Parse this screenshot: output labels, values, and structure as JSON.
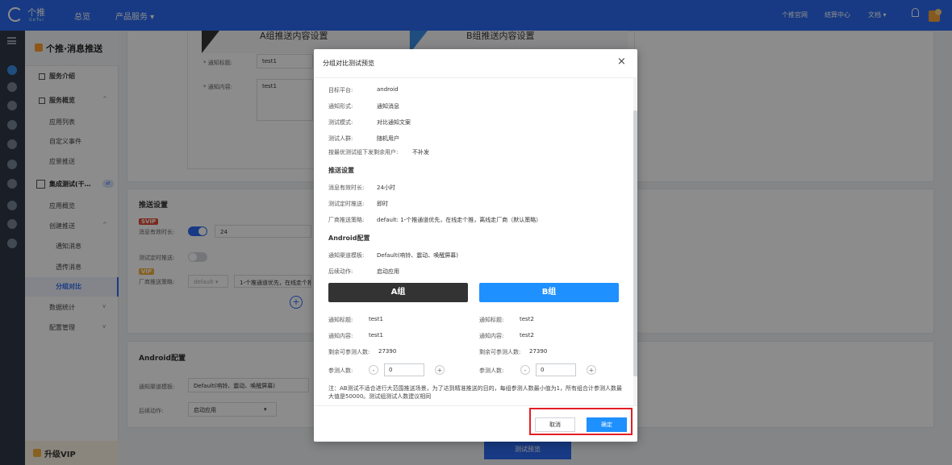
{
  "topbar": {
    "logo_text": "个推",
    "logo_sub": "GeTui",
    "nav": [
      "总览",
      "产品服务 ▾"
    ],
    "right": [
      "个推官网",
      "结算中心",
      "文档 ▾"
    ]
  },
  "sidebar": {
    "title": "个推·消息推送",
    "items": [
      {
        "label": "服务介绍"
      },
      {
        "label": "服务概览",
        "chev": "^"
      },
      {
        "label": "应用列表"
      },
      {
        "label": "自定义事件"
      },
      {
        "label": "应景推送"
      },
      {
        "label": "集成测试(干…",
        "toggle": "⇄"
      },
      {
        "label": "应用概览"
      },
      {
        "label": "创建推送",
        "chev": "^"
      },
      {
        "label": "通知消息"
      },
      {
        "label": "透传消息"
      },
      {
        "label": "分组对比"
      },
      {
        "label": "数据统计",
        "chev": "v"
      },
      {
        "label": "配置管理",
        "chev": "v"
      }
    ],
    "vip": "升级VIP"
  },
  "background": {
    "groupA_title": "A组推送内容设置",
    "groupB_title": "B组推送内容设置",
    "notif_title_label": "* 通知标题:",
    "notif_title_value": "test1",
    "notif_content_label": "* 通知内容:",
    "notif_content_value": "test1",
    "push_settings": "推送设置",
    "svip": "SVIP",
    "ttl_label": "消息有效时长:",
    "ttl_value": "24",
    "timed_label": "测试定时推送:",
    "vip": "VIP",
    "vendor_label": "厂商推送策略:",
    "vendor_select": "default ▾",
    "vendor_value": "1-个推通道优先，在线走个推",
    "android_title": "Android配置",
    "channel_label": "通知渠道模板:",
    "channel_value": "Default(响铃、震动、唤醒屏幕)",
    "after_label": "后续动作:",
    "after_value": "启动应用",
    "after_arrow": "▾",
    "test_preview": "测试预览",
    "plus": "+"
  },
  "modal": {
    "title": "分组对比测试预览",
    "close": "×",
    "rows": [
      {
        "label": "目标平台:",
        "value": "android"
      },
      {
        "label": "通知形式:",
        "value": "通知消息"
      },
      {
        "label": "测试模式:",
        "value": "对比通知文案"
      },
      {
        "label": "测试人群:",
        "value": "随机用户"
      }
    ],
    "optimal_label": "按最优测试组下发剩余用户:",
    "optimal_value": "不补发",
    "push_section": "推送设置",
    "push_rows": [
      {
        "label": "消息有效时长:",
        "value": "24小时"
      },
      {
        "label": "测试定时推送:",
        "value": "即时"
      },
      {
        "label": "厂商推送策略:",
        "value": "default: 1-个推通道优先，在线走个推，离线走厂商（默认策略）"
      }
    ],
    "android_section": "Android配置",
    "android_rows": [
      {
        "label": "通知渠道模板:",
        "value": "Default(响铃、震动、唤醒屏幕)"
      },
      {
        "label": "后续动作:",
        "value": "启动应用"
      }
    ],
    "group_a": {
      "name": "A组",
      "title_label": "通知标题:",
      "title_value": "test1",
      "content_label": "通知内容:",
      "content_value": "test1",
      "remain_label": "剩余可参测人数:",
      "remain_value": "27390",
      "count_label": "参测人数:",
      "count_value": "0"
    },
    "group_b": {
      "name": "B组",
      "title_label": "通知标题:",
      "title_value": "test2",
      "content_label": "通知内容:",
      "content_value": "test2",
      "remain_label": "剩余可参测人数:",
      "remain_value": "27390",
      "count_label": "参测人数:",
      "count_value": "0"
    },
    "minus": "-",
    "plus": "+",
    "note": "注：AB测试不适合进行大范围推送场景，为了达到精准推送的目的，每组参测人数最小值为1，所有组合计参测人数最大值是50000。测试组测试人数建议相同",
    "cancel": "取消",
    "ok": "确定"
  }
}
